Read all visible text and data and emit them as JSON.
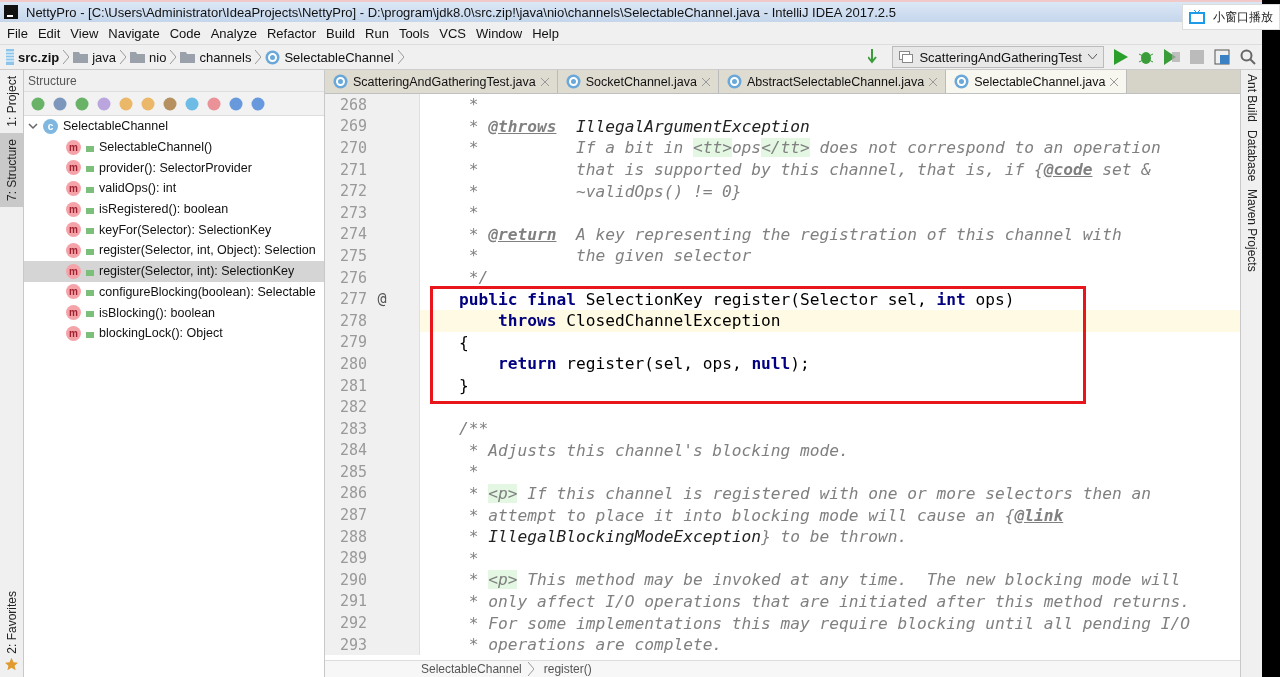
{
  "window": {
    "title": "NettyPro - [C:\\Users\\Administrator\\IdeaProjects\\NettyPro] - D:\\program\\jdk8.0\\src.zip!\\java\\nio\\channels\\SelectableChannel.java - IntelliJ IDEA 2017.2.5"
  },
  "overlay_button": {
    "label": "小窗口播放"
  },
  "menu": [
    "File",
    "Edit",
    "View",
    "Navigate",
    "Code",
    "Analyze",
    "Refactor",
    "Build",
    "Run",
    "Tools",
    "VCS",
    "Window",
    "Help"
  ],
  "breadcrumb": [
    {
      "label": "src.zip",
      "kind": "archive"
    },
    {
      "label": "java",
      "kind": "folder"
    },
    {
      "label": "nio",
      "kind": "folder"
    },
    {
      "label": "channels",
      "kind": "folder"
    },
    {
      "label": "SelectableChannel",
      "kind": "class"
    }
  ],
  "run_config": {
    "label": "ScatteringAndGatheringTest"
  },
  "left_tool_windows": [
    {
      "label": "1: Project",
      "selected": false
    },
    {
      "label": "7: Structure",
      "selected": true
    }
  ],
  "left_bottom_tool_windows": [
    {
      "label": "2: Favorites",
      "selected": false
    }
  ],
  "right_tool_windows": [
    {
      "label": "Ant Build"
    },
    {
      "label": "Database"
    },
    {
      "label": "Maven Projects"
    }
  ],
  "structure": {
    "title": "Structure",
    "root": {
      "label": "SelectableChannel",
      "badge": "c",
      "expanded": true,
      "children": [
        {
          "label": "SelectableChannel()",
          "badge": "m",
          "selected": false
        },
        {
          "label": "provider(): SelectorProvider",
          "badge": "m",
          "selected": false
        },
        {
          "label": "validOps(): int",
          "badge": "m",
          "selected": false
        },
        {
          "label": "isRegistered(): boolean",
          "badge": "m",
          "selected": false
        },
        {
          "label": "keyFor(Selector): SelectionKey",
          "badge": "m",
          "selected": false
        },
        {
          "label": "register(Selector, int, Object): Selection",
          "badge": "m",
          "selected": false
        },
        {
          "label": "register(Selector, int): SelectionKey",
          "badge": "m",
          "selected": true
        },
        {
          "label": "configureBlocking(boolean): Selectable",
          "badge": "m",
          "selected": false
        },
        {
          "label": "isBlocking(): boolean",
          "badge": "m",
          "selected": false
        },
        {
          "label": "blockingLock(): Object",
          "badge": "m",
          "selected": false
        }
      ]
    }
  },
  "tabs": [
    {
      "label": "ScatteringAndGatheringTest.java",
      "selected": false
    },
    {
      "label": "SocketChannel.java",
      "selected": false
    },
    {
      "label": "AbstractSelectableChannel.java",
      "selected": false
    },
    {
      "label": "SelectableChannel.java",
      "selected": true
    }
  ],
  "code": {
    "blocks": [
      {
        "framed": false,
        "lines": [
          {
            "number": "268",
            "current": false,
            "tokens": [
              {
                "kind": "comment",
                "text": "     *"
              }
            ]
          },
          {
            "number": "269",
            "current": false,
            "tokens": [
              {
                "kind": "comment",
                "text": "     * "
              },
              {
                "kind": "doc_tag",
                "text": "@throws"
              },
              {
                "kind": "doc_ref",
                "text": "  IllegalArgumentException"
              }
            ]
          },
          {
            "number": "270",
            "current": false,
            "tokens": [
              {
                "kind": "comment",
                "text": "     *          If a bit in "
              },
              {
                "kind": "html",
                "text": "<tt>"
              },
              {
                "kind": "comment",
                "text": "ops"
              },
              {
                "kind": "html",
                "text": "</tt>"
              },
              {
                "kind": "comment",
                "text": " does not correspond to an operation"
              }
            ]
          },
          {
            "number": "271",
            "current": false,
            "tokens": [
              {
                "kind": "comment",
                "text": "     *          that is supported by this channel, that is, if {"
              },
              {
                "kind": "doc_tag",
                "text": "@code"
              },
              {
                "kind": "comment",
                "text": " set &"
              }
            ]
          },
          {
            "number": "272",
            "current": false,
            "tokens": [
              {
                "kind": "comment",
                "text": "     *          ~validOps() != 0}"
              }
            ]
          },
          {
            "number": "273",
            "current": false,
            "tokens": [
              {
                "kind": "comment",
                "text": "     *"
              }
            ]
          },
          {
            "number": "274",
            "current": false,
            "tokens": [
              {
                "kind": "comment",
                "text": "     * "
              },
              {
                "kind": "doc_tag",
                "text": "@return"
              },
              {
                "kind": "comment",
                "text": "  A key representing the registration of this channel with"
              }
            ]
          },
          {
            "number": "275",
            "current": false,
            "tokens": [
              {
                "kind": "comment",
                "text": "     *          the given selector"
              }
            ]
          },
          {
            "number": "276",
            "current": false,
            "tokens": [
              {
                "kind": "comment",
                "text": "     */"
              }
            ]
          }
        ]
      },
      {
        "framed": true,
        "lines": [
          {
            "number": "277",
            "current": false,
            "gutter_mark": "@",
            "tokens": [
              {
                "kind": "keyword",
                "text": "    public final "
              },
              {
                "kind": "plain",
                "text": "SelectionKey register(Selector sel, "
              },
              {
                "kind": "keyword",
                "text": "int"
              },
              {
                "kind": "plain",
                "text": " ops)"
              }
            ]
          },
          {
            "number": "278",
            "current": true,
            "tokens": [
              {
                "kind": "keyword",
                "text": "        throws "
              },
              {
                "kind": "plain",
                "text": "ClosedChannelException"
              }
            ]
          },
          {
            "number": "279",
            "current": false,
            "tokens": [
              {
                "kind": "plain",
                "text": "    {"
              }
            ]
          },
          {
            "number": "280",
            "current": false,
            "tokens": [
              {
                "kind": "keyword",
                "text": "        return"
              },
              {
                "kind": "plain",
                "text": " register(sel, ops, "
              },
              {
                "kind": "keyword",
                "text": "null"
              },
              {
                "kind": "plain",
                "text": ");"
              }
            ]
          },
          {
            "number": "281",
            "current": false,
            "tokens": [
              {
                "kind": "plain",
                "text": "    }"
              }
            ]
          }
        ]
      },
      {
        "framed": false,
        "lines": [
          {
            "number": "282",
            "current": false
          },
          {
            "number": "283",
            "current": false,
            "tokens": [
              {
                "kind": "comment",
                "text": "    /**"
              }
            ]
          },
          {
            "number": "284",
            "current": false,
            "tokens": [
              {
                "kind": "comment",
                "text": "     * Adjusts this channel's blocking mode."
              }
            ]
          },
          {
            "number": "285",
            "current": false,
            "tokens": [
              {
                "kind": "comment",
                "text": "     *"
              }
            ]
          },
          {
            "number": "286",
            "current": false,
            "tokens": [
              {
                "kind": "comment",
                "text": "     * "
              },
              {
                "kind": "html",
                "text": "<p>"
              },
              {
                "kind": "comment",
                "text": " If this channel is registered with one or more selectors then an"
              }
            ]
          },
          {
            "number": "287",
            "current": false,
            "tokens": [
              {
                "kind": "comment",
                "text": "     * attempt to place it into blocking mode will cause an {"
              },
              {
                "kind": "doc_tag",
                "text": "@link"
              }
            ]
          },
          {
            "number": "288",
            "current": false,
            "tokens": [
              {
                "kind": "comment",
                "text": "     * "
              },
              {
                "kind": "doc_ref",
                "text": "IllegalBlockingModeException"
              },
              {
                "kind": "comment",
                "text": "} to be thrown."
              }
            ]
          },
          {
            "number": "289",
            "current": false,
            "tokens": [
              {
                "kind": "comment",
                "text": "     *"
              }
            ]
          },
          {
            "number": "290",
            "current": false,
            "tokens": [
              {
                "kind": "comment",
                "text": "     * "
              },
              {
                "kind": "html",
                "text": "<p>"
              },
              {
                "kind": "comment",
                "text": " This method may be invoked at any time.  The new blocking mode will"
              }
            ]
          },
          {
            "number": "291",
            "current": false,
            "tokens": [
              {
                "kind": "comment",
                "text": "     * only affect I/O operations that are initiated after this method returns."
              }
            ]
          },
          {
            "number": "292",
            "current": false,
            "tokens": [
              {
                "kind": "comment",
                "text": "     * For some implementations this may require blocking until all pending I/O"
              }
            ]
          },
          {
            "number": "293",
            "current": false,
            "tokens": [
              {
                "kind": "comment",
                "text": "     * operations are complete."
              }
            ]
          }
        ]
      }
    ]
  },
  "editor_breadcrumb": [
    "SelectableChannel",
    "register()"
  ]
}
